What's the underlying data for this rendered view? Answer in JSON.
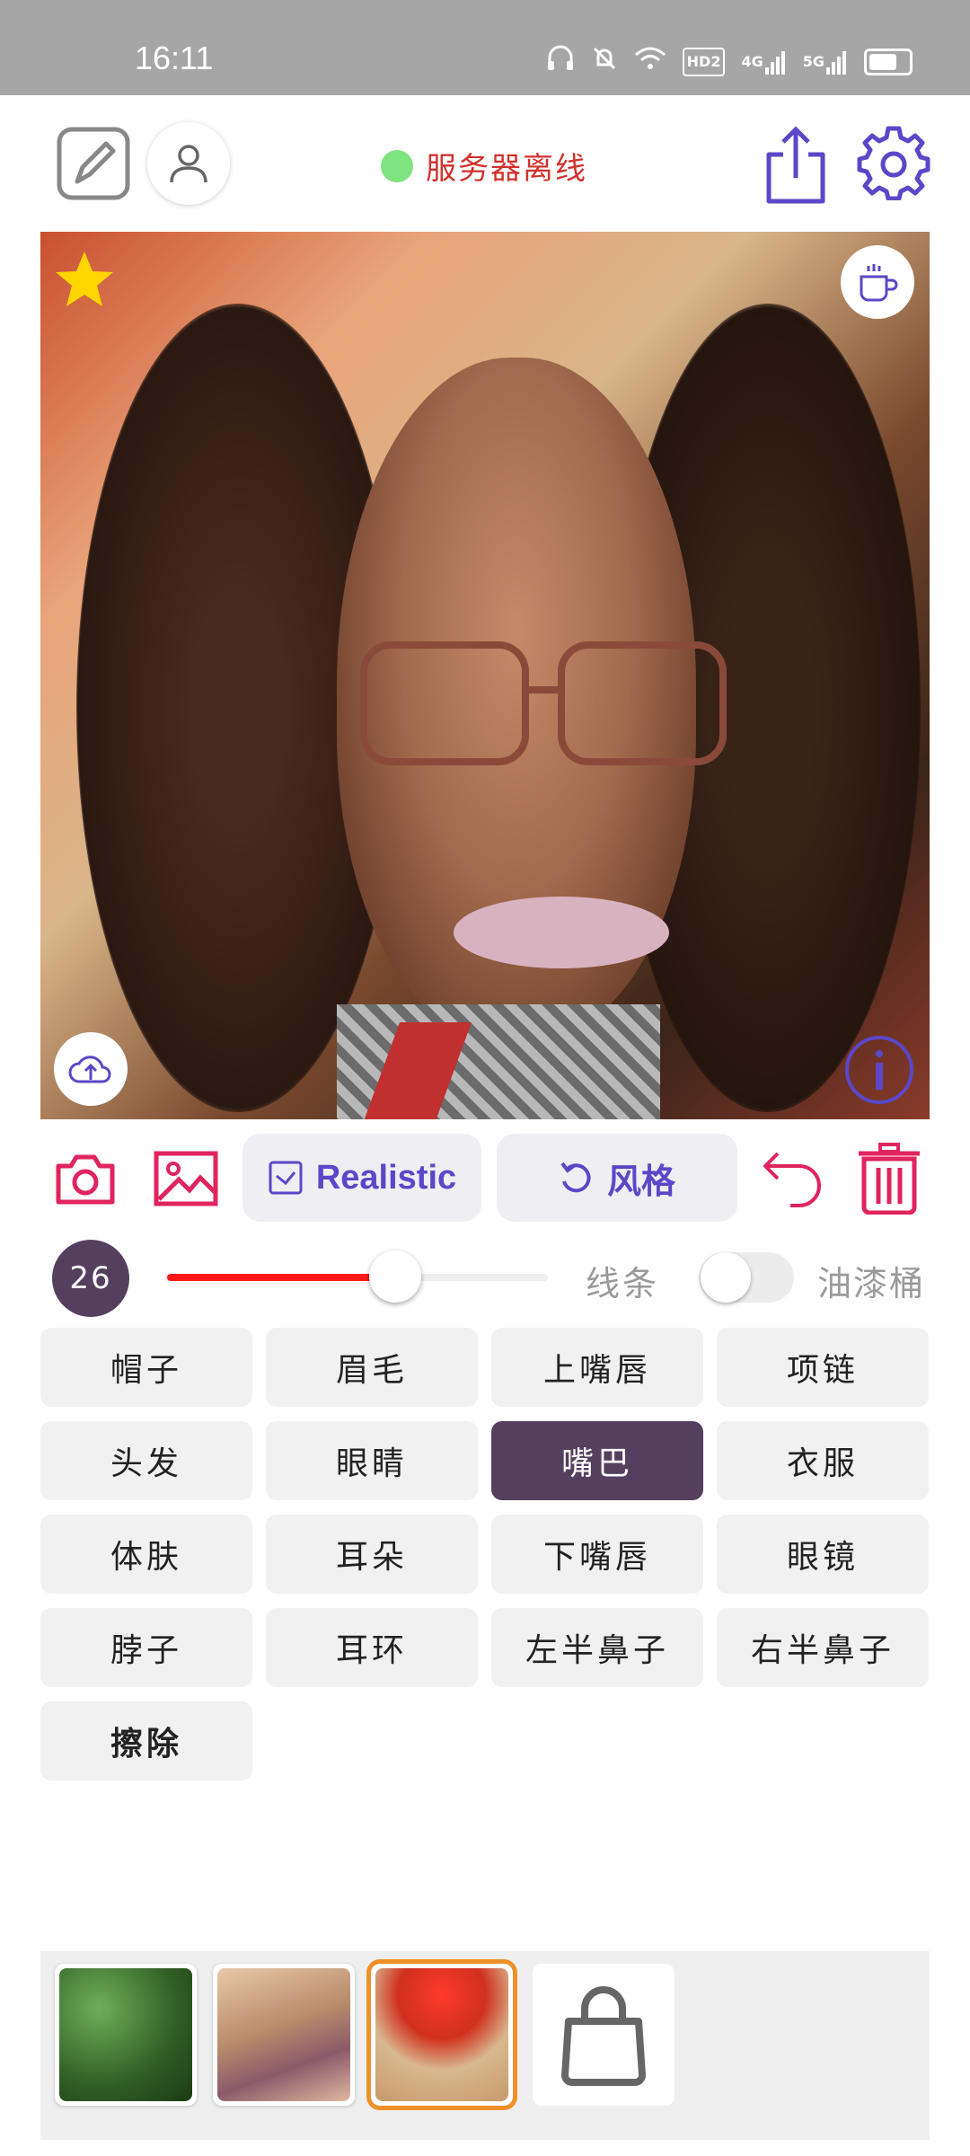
{
  "status": {
    "time": "16:11",
    "icons": [
      "headphones-icon",
      "bell-off-icon",
      "wifi-icon",
      "hd2-icon",
      "4g-signal-icon",
      "5g-signal-icon",
      "battery-icon"
    ],
    "hd_label": "HD2",
    "net4g": "4G",
    "net5g": "5G"
  },
  "header": {
    "server_status": "服务器离线",
    "server_status_color": "#7fe37f"
  },
  "toolbar": {
    "style_primary": "Realistic",
    "style_button": "风格"
  },
  "brush": {
    "size": "26",
    "slider_fraction": 0.6,
    "line_label": "线条",
    "bucket_label": "油漆桶",
    "bucket_enabled": false
  },
  "parts": [
    {
      "label": "帽子"
    },
    {
      "label": "眉毛"
    },
    {
      "label": "上嘴唇"
    },
    {
      "label": "项链"
    },
    {
      "label": "头发"
    },
    {
      "label": "眼睛"
    },
    {
      "label": "嘴巴",
      "active": true
    },
    {
      "label": "衣服"
    },
    {
      "label": "体肤"
    },
    {
      "label": "耳朵"
    },
    {
      "label": "下嘴唇"
    },
    {
      "label": "眼镜"
    },
    {
      "label": "脖子"
    },
    {
      "label": "耳环"
    },
    {
      "label": "左半鼻子"
    },
    {
      "label": "右半鼻子"
    },
    {
      "label": "擦除",
      "bold": true
    }
  ],
  "colors": {
    "accent_purple": "#5b47c7",
    "accent_red": "#e0245e",
    "active_cell": "#54405e",
    "slider_fill": "#ff1a1a"
  },
  "styles": [
    {
      "name": "green-foliage-style"
    },
    {
      "name": "lace-texture-style"
    },
    {
      "name": "red-tree-style",
      "selected": true
    },
    {
      "name": "shop-bag-icon"
    }
  ]
}
